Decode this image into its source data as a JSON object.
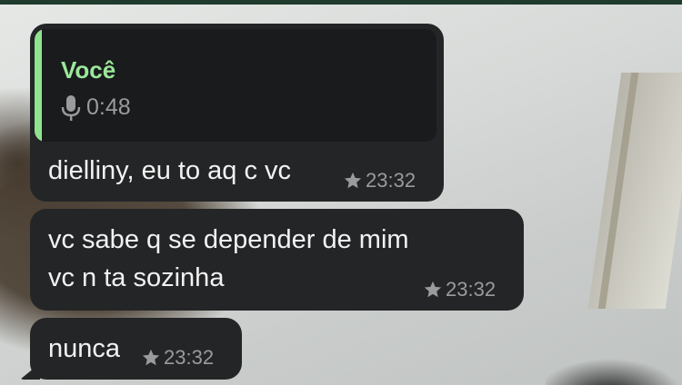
{
  "colors": {
    "bubble_bg": "#242527",
    "reply_bg": "#1a1b1d",
    "reply_accent": "#8fe38f",
    "meta_text": "#9a9b9d",
    "message_text": "#f2f2f2"
  },
  "messages": [
    {
      "reply": {
        "author": "Você",
        "type_icon": "microphone-icon",
        "duration": "0:48"
      },
      "text": "dielliny, eu to aq c vc",
      "starred": true,
      "time": "23:32"
    },
    {
      "lines": [
        "vc sabe q se depender de mim",
        "vc n ta sozinha"
      ],
      "starred": true,
      "time": "23:32"
    },
    {
      "text": "nunca",
      "starred": true,
      "time": "23:32"
    }
  ]
}
